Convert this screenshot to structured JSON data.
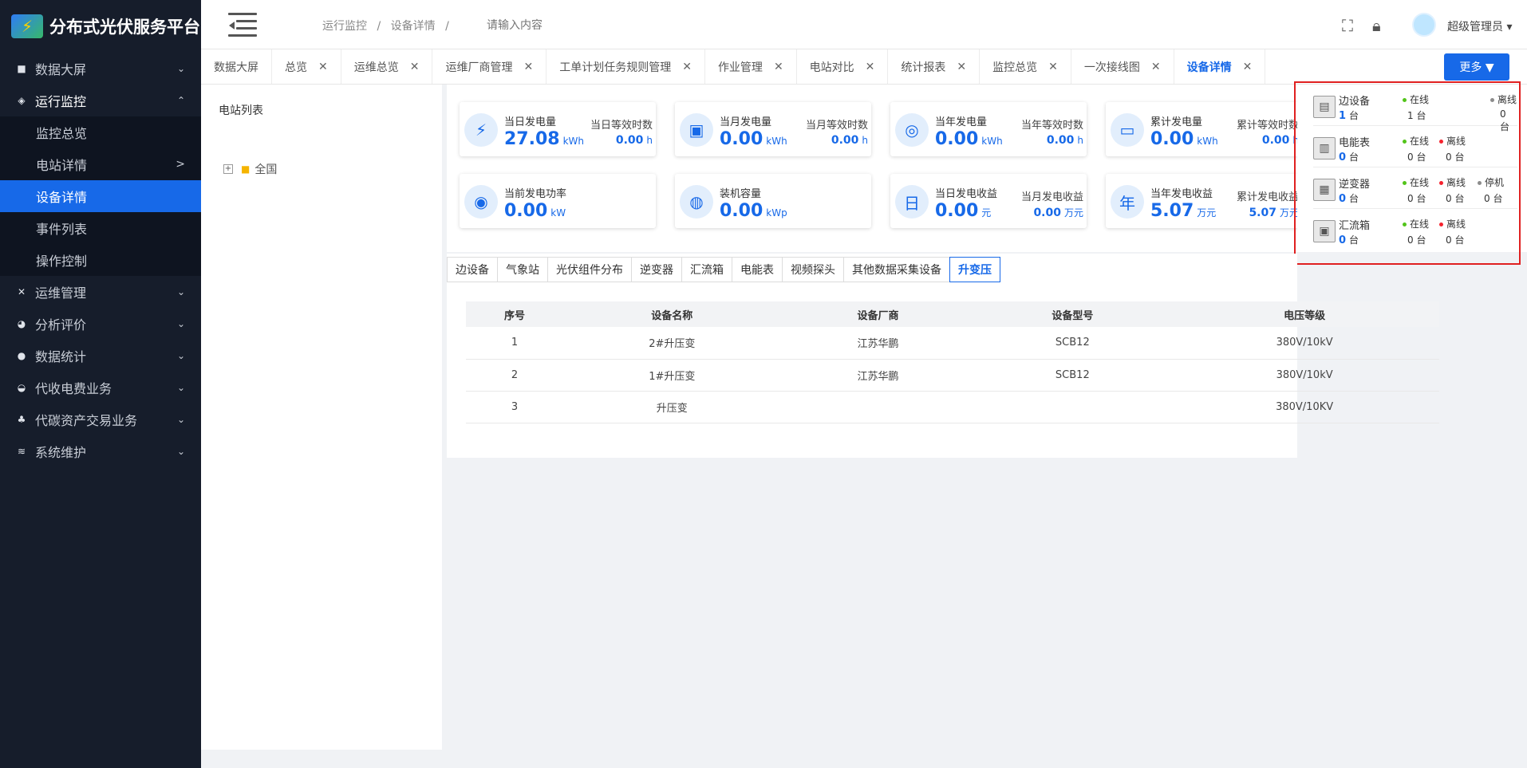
{
  "brand": {
    "title": "分布式光伏服务平台"
  },
  "sidebar": {
    "items": [
      {
        "label": "数据大屏"
      },
      {
        "label": "运行监控"
      },
      {
        "label": "运维管理"
      },
      {
        "label": "分析评价"
      },
      {
        "label": "数据统计"
      },
      {
        "label": "代收电费业务"
      },
      {
        "label": "代碳资产交易业务"
      },
      {
        "label": "系统维护"
      }
    ],
    "sub_items": [
      {
        "label": "监控总览"
      },
      {
        "label": "电站详情",
        "arrow": ">"
      },
      {
        "label": "设备详情"
      },
      {
        "label": "事件列表"
      },
      {
        "label": "操作控制"
      }
    ]
  },
  "header": {
    "breadcrumb": [
      "运行监控",
      "设备详情"
    ],
    "breadcrumb_sep": "/",
    "search_placeholder": "请输入内容",
    "user": "超级管理员"
  },
  "tabs": [
    {
      "label": "数据大屏",
      "closable": false
    },
    {
      "label": "总览"
    },
    {
      "label": "运维总览"
    },
    {
      "label": "运维厂商管理"
    },
    {
      "label": "工单计划任务规则管理"
    },
    {
      "label": "作业管理"
    },
    {
      "label": "电站对比"
    },
    {
      "label": "统计报表"
    },
    {
      "label": "监控总览"
    },
    {
      "label": "一次接线图"
    },
    {
      "label": "设备详情",
      "active": true
    }
  ],
  "more_button": "更多 ▼",
  "station_list": {
    "title": "电站列表",
    "tree_root": "全国"
  },
  "cards": [
    {
      "label": "当日发电量",
      "value": "27.08",
      "unit": "kWh",
      "label2": "当日等效时数",
      "value2": "0.00",
      "unit2": "h",
      "icon": "⚡"
    },
    {
      "label": "当月发电量",
      "value": "0.00",
      "unit": "kWh",
      "label2": "当月等效时数",
      "value2": "0.00",
      "unit2": "h",
      "icon": "▣"
    },
    {
      "label": "当年发电量",
      "value": "0.00",
      "unit": "kWh",
      "label2": "当年等效时数",
      "value2": "0.00",
      "unit2": "h",
      "icon": "◎"
    },
    {
      "label": "累计发电量",
      "value": "0.00",
      "unit": "kWh",
      "label2": "累计等效时数",
      "value2": "0.00",
      "unit2": "h",
      "icon": "▭"
    },
    {
      "label": "当前发电功率",
      "value": "0.00",
      "unit": "kW",
      "label2": "",
      "value2": "",
      "unit2": "",
      "icon": "◉"
    },
    {
      "label": "装机容量",
      "value": "0.00",
      "unit": "kWp",
      "label2": "",
      "value2": "",
      "unit2": "",
      "icon": "◍"
    },
    {
      "label": "当日发电收益",
      "value": "0.00",
      "unit": "元",
      "label2": "当月发电收益",
      "value2": "0.00",
      "unit2": "万元",
      "icon": "日"
    },
    {
      "label": "当年发电收益",
      "value": "5.07",
      "unit": "万元",
      "label2": "累计发电收益",
      "value2": "5.07",
      "unit2": "万元",
      "icon": "年"
    }
  ],
  "device_summary": [
    {
      "name": "边设备",
      "count": "1",
      "unit": "台",
      "statuses": [
        {
          "label": "在线",
          "color": "#52c41a",
          "count": "1 台"
        },
        {
          "label": "离线",
          "color": "#8c8c8c",
          "count": "0 台"
        }
      ],
      "icon": "▤"
    },
    {
      "name": "电能表",
      "count": "0",
      "unit": "台",
      "statuses": [
        {
          "label": "在线",
          "color": "#52c41a",
          "count": "0 台"
        },
        {
          "label": "离线",
          "color": "#f5222d",
          "count": "0 台"
        }
      ],
      "icon": "▥"
    },
    {
      "name": "逆变器",
      "count": "0",
      "unit": "台",
      "statuses": [
        {
          "label": "在线",
          "color": "#52c41a",
          "count": "0 台"
        },
        {
          "label": "离线",
          "color": "#f5222d",
          "count": "0 台"
        },
        {
          "label": "停机",
          "color": "#8c8c8c",
          "count": "0 台"
        }
      ],
      "icon": "▦"
    },
    {
      "name": "汇流箱",
      "count": "0",
      "unit": "台",
      "statuses": [
        {
          "label": "在线",
          "color": "#52c41a",
          "count": "0 台"
        },
        {
          "label": "离线",
          "color": "#f5222d",
          "count": "0 台"
        }
      ],
      "icon": "▣"
    }
  ],
  "device_type_tabs": [
    "边设备",
    "气象站",
    "光伏组件分布",
    "逆变器",
    "汇流箱",
    "电能表",
    "视频探头",
    "其他数据采集设备",
    "升变压"
  ],
  "active_device_type": "升变压",
  "table": {
    "headers": [
      "序号",
      "设备名称",
      "设备厂商",
      "设备型号",
      "电压等级"
    ],
    "rows": [
      [
        "1",
        "2#升压变",
        "江苏华鹏",
        "SCB12",
        "380V/10kV"
      ],
      [
        "2",
        "1#升压变",
        "江苏华鹏",
        "SCB12",
        "380V/10kV"
      ],
      [
        "3",
        "升压变",
        "",
        "",
        "380V/10KV"
      ]
    ]
  },
  "colors": {
    "accent": "#1769e8",
    "sidebar_bg": "#161d2b",
    "highlight_box": "#e02020"
  }
}
